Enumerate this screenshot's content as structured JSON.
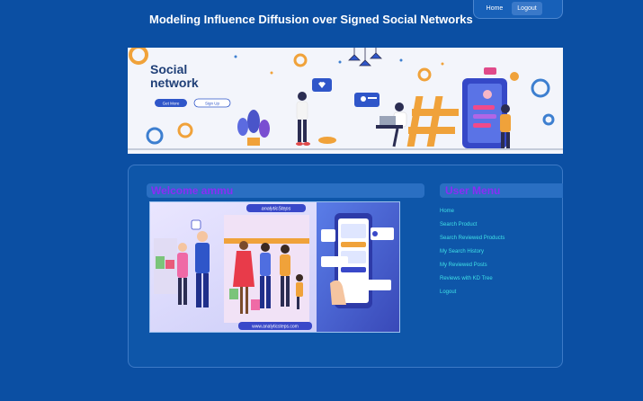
{
  "site": {
    "title": "Modeling Influence Diffusion over Signed Social Networks"
  },
  "topnav": {
    "home": "Home",
    "logout": "Logout"
  },
  "banner": {
    "heading_line1": "Social",
    "heading_line2": "network",
    "get_more": "Get More",
    "sign_up": "Sign Up"
  },
  "welcome": {
    "title": "Welcome ammu"
  },
  "feature_image": {
    "logo_text": "analyticSteps",
    "url_text": "www.analyticsteps.com"
  },
  "user_menu": {
    "title": "User Menu",
    "items": [
      {
        "label": "Home"
      },
      {
        "label": "Search Product"
      },
      {
        "label": "Search Reviewed Products"
      },
      {
        "label": "My Search History"
      },
      {
        "label": "My Reviewed Posts"
      },
      {
        "label": "Reviews with KD Tree"
      },
      {
        "label": "Logout"
      }
    ]
  },
  "colors": {
    "page_bg": "#0b4fa3",
    "panel_bg": "#0e56a9",
    "bar_bg": "#2a6fc2",
    "heading_purple": "#8b2cf5",
    "menu_link": "#3fe0e6"
  },
  "icons": [
    "gear-icon",
    "heart-icon",
    "hashtag-icon",
    "plant-icon",
    "profile-icon"
  ]
}
